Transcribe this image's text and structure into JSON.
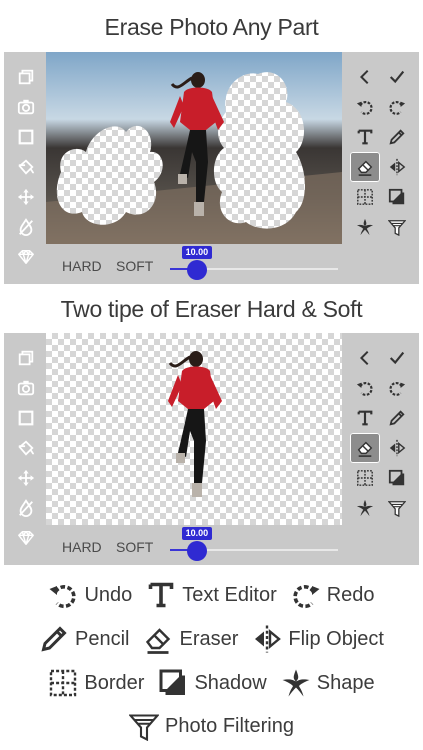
{
  "headings": {
    "top": "Erase Photo Any Part",
    "middle": "Two tipe of Eraser Hard & Soft"
  },
  "editor": {
    "left_tools": [
      "layers-icon",
      "camera-icon",
      "square-icon",
      "paint-bucket-icon",
      "move-icon",
      "no-color-icon",
      "diamond-icon"
    ],
    "right_tools": [
      [
        "back-icon",
        "check-icon"
      ],
      [
        "undo-icon",
        "redo-icon"
      ],
      [
        "text-icon",
        "pencil-icon"
      ],
      [
        "eraser-icon",
        "flip-icon"
      ],
      [
        "border-icon",
        "shadow-icon"
      ],
      [
        "shape-icon",
        "filter-icon"
      ]
    ],
    "active_tool": "eraser-icon",
    "hard_label": "HARD",
    "soft_label": "SOFT",
    "slider_value": "10.00",
    "slider_fraction": 0.16,
    "accent": "#2f2ad2"
  },
  "legend": {
    "undo": "Undo",
    "text_editor": "Text Editor",
    "redo": "Redo",
    "pencil": "Pencil",
    "eraser": "Eraser",
    "flip_object": "Flip Object",
    "border": "Border",
    "shadow": "Shadow",
    "shape": "Shape",
    "photo_filtering": "Photo Filtering"
  }
}
